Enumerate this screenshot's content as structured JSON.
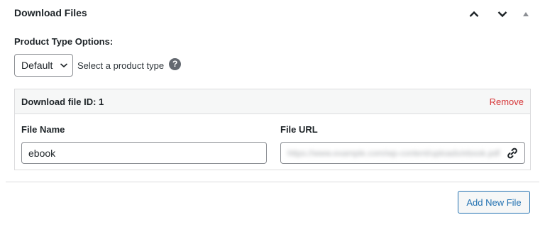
{
  "panel": {
    "title": "Download Files"
  },
  "product_type": {
    "label": "Product Type Options:",
    "selected": "Default",
    "hint": "Select a product type",
    "help_glyph": "?"
  },
  "download_file": {
    "id_label": "Download file ID: 1",
    "remove_label": "Remove",
    "name_label": "File Name",
    "name_value": "ebook",
    "url_label": "File URL",
    "url_value": "https://www.example.com/wp-content/uploads/ebook.pdf"
  },
  "actions": {
    "add_new_file": "Add New File"
  },
  "colors": {
    "accent": "#2271b1",
    "danger": "#d63638",
    "border": "#dcdcde",
    "header_bg": "#f6f7f7"
  },
  "icons": {
    "move_up": "chevron-up-icon",
    "move_down": "chevron-down-icon",
    "toggle": "triangle-up-icon",
    "select_caret": "chevron-down-icon",
    "help": "question-circle-icon",
    "link": "link-icon"
  }
}
